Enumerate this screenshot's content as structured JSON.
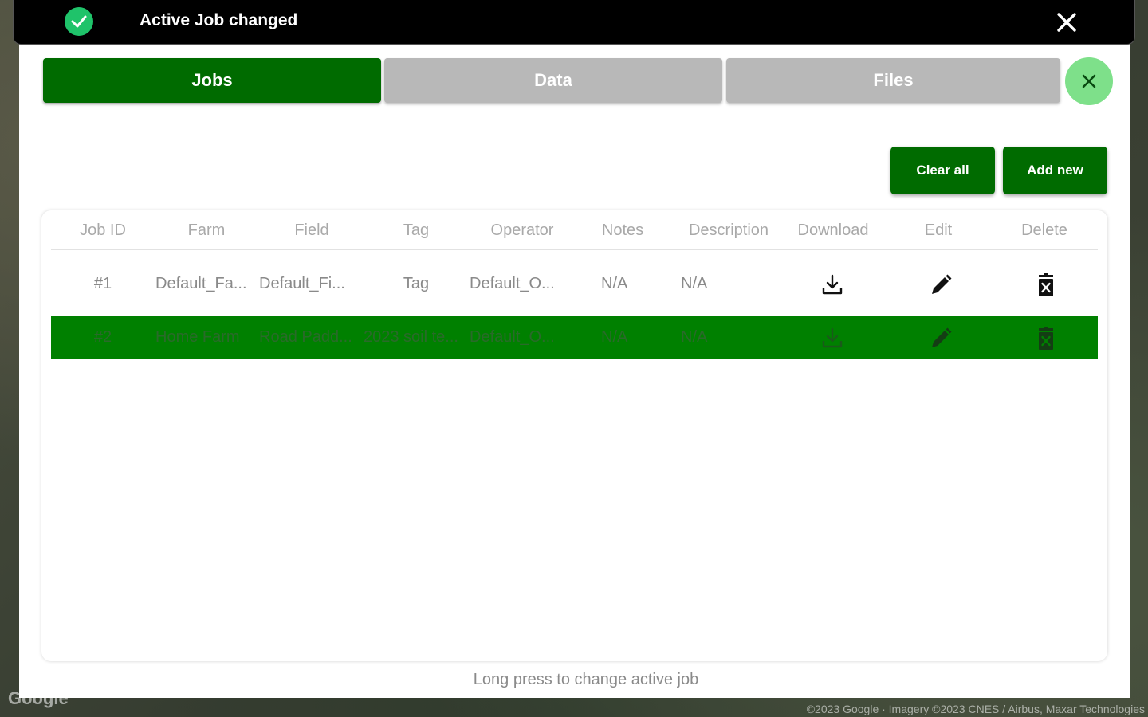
{
  "toast": {
    "message": "Active Job changed",
    "icon": "check-circle-icon",
    "close_icon": "close-icon"
  },
  "tabs": [
    {
      "label": "Jobs",
      "active": true
    },
    {
      "label": "Data",
      "active": false
    },
    {
      "label": "Files",
      "active": false
    }
  ],
  "actions": {
    "clear_all": "Clear all",
    "add_new": "Add new"
  },
  "table": {
    "columns": [
      "Job ID",
      "Farm",
      "Field",
      "Tag",
      "Operator",
      "Notes",
      "Description",
      "Download",
      "Edit",
      "Delete"
    ],
    "rows": [
      {
        "job_id": "#1",
        "farm": "Default_Fa...",
        "field": "Default_Fi...",
        "tag": "Tag",
        "operator": "Default_O...",
        "notes": "N/A",
        "description": "N/A",
        "active": false
      },
      {
        "job_id": "#2",
        "farm": "Home Farm",
        "field": "Road Padd...",
        "tag": "2023 soil te...",
        "operator": "Default_O...",
        "notes": "N/A",
        "description": "N/A",
        "active": true
      }
    ]
  },
  "hint": "Long press to change active job",
  "map": {
    "brand": "Google",
    "attribution": "©2023 Google · Imagery ©2023 CNES / Airbus, Maxar Technologies"
  },
  "colors": {
    "primary": "#006b00",
    "active_row": "#008000",
    "close_circle": "#7ee08a",
    "toast_check": "#1fc36a",
    "inactive_tab": "#b8b8b8"
  }
}
